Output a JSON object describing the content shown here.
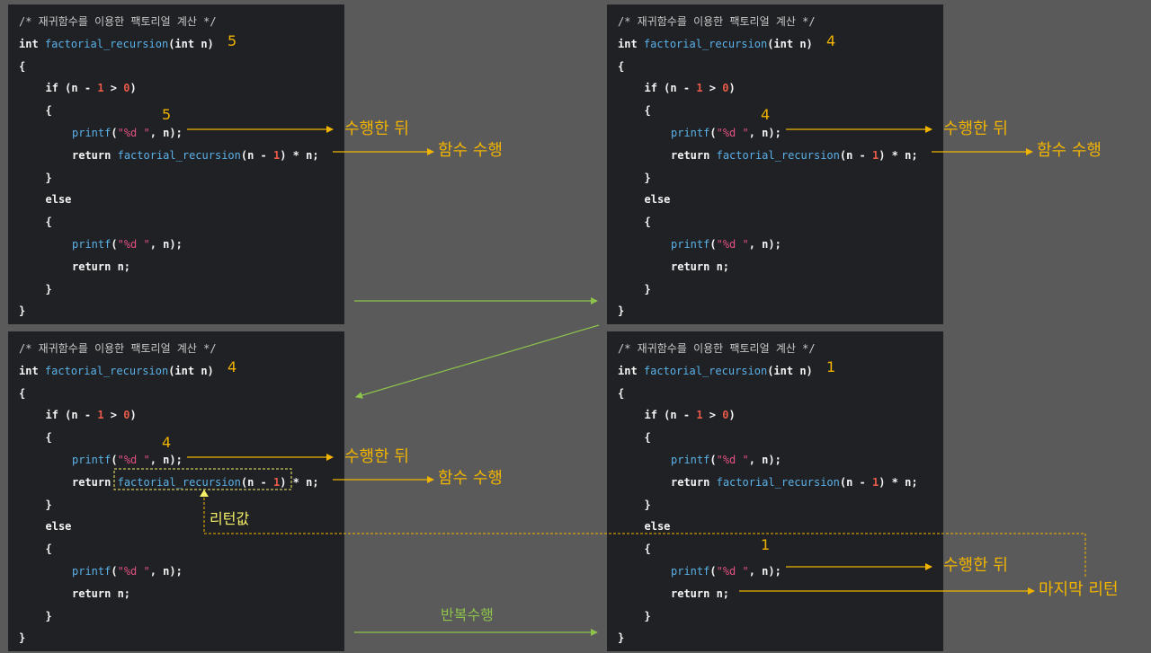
{
  "panels": [
    {
      "comment": "/* 재귀함수를 이용한 팩토리얼 계산 */",
      "type_kw": "int",
      "func_name": "factorial_recursion",
      "params": "(int n)",
      "open_brace": "{",
      "if_kw": "if",
      "cond_pre": " (n - ",
      "cond_num1": "1",
      "cond_mid": " > ",
      "cond_num2": "0",
      "cond_post": ")",
      "printf_fn": "printf",
      "printf_open": "(",
      "printf_str": "\"%d \"",
      "printf_args": ", n);",
      "return_kw": "return",
      "rec_call_pre": "(n - ",
      "rec_call_num": "1",
      "rec_call_post": ") * n;",
      "close_brace": "}",
      "else_kw": "else",
      "return_n": " n;",
      "param_value": "5",
      "printf_value": "5"
    },
    {
      "comment": "/* 재귀함수를 이용한 팩토리얼 계산 */",
      "type_kw": "int",
      "func_name": "factorial_recursion",
      "params": "(int n)",
      "open_brace": "{",
      "if_kw": "if",
      "cond_pre": " (n - ",
      "cond_num1": "1",
      "cond_mid": " > ",
      "cond_num2": "0",
      "cond_post": ")",
      "printf_fn": "printf",
      "printf_open": "(",
      "printf_str": "\"%d \"",
      "printf_args": ", n);",
      "return_kw": "return",
      "rec_call_pre": "(n - ",
      "rec_call_num": "1",
      "rec_call_post": ") * n;",
      "close_brace": "}",
      "else_kw": "else",
      "return_n": " n;",
      "param_value": "4",
      "printf_value": "4"
    },
    {
      "comment": "/* 재귀함수를 이용한 팩토리얼 계산 */",
      "type_kw": "int",
      "func_name": "factorial_recursion",
      "params": "(int n)",
      "open_brace": "{",
      "if_kw": "if",
      "cond_pre": " (n - ",
      "cond_num1": "1",
      "cond_mid": " > ",
      "cond_num2": "0",
      "cond_post": ")",
      "printf_fn": "printf",
      "printf_open": "(",
      "printf_str": "\"%d \"",
      "printf_args": ", n);",
      "return_kw": "return",
      "rec_call_pre": "(n - ",
      "rec_call_num": "1",
      "rec_call_post": ") * n;",
      "close_brace": "}",
      "else_kw": "else",
      "return_n": " n;",
      "param_value": "4",
      "printf_value": "4"
    },
    {
      "comment": "/* 재귀함수를 이용한 팩토리얼 계산 */",
      "type_kw": "int",
      "func_name": "factorial_recursion",
      "params": "(int n)",
      "open_brace": "{",
      "if_kw": "if",
      "cond_pre": " (n - ",
      "cond_num1": "1",
      "cond_mid": " > ",
      "cond_num2": "0",
      "cond_post": ")",
      "printf_fn": "printf",
      "printf_open": "(",
      "printf_str": "\"%d \"",
      "printf_args": ", n);",
      "return_kw": "return",
      "rec_call_pre": "(n - ",
      "rec_call_num": "1",
      "rec_call_post": ") * n;",
      "close_brace": "}",
      "else_kw": "else",
      "return_n": " n;",
      "param_value": "1",
      "printf_value": "1"
    }
  ],
  "annotations": {
    "after_exec": "수행한 뒤",
    "func_exec": "함수 수행",
    "return_value": "리턴값",
    "repeat": "반복수행",
    "last_return": "마지막 리턴"
  },
  "colors": {
    "background": "#5a5a5a",
    "panel": "#202124",
    "arrow_orange": "#f0b300",
    "arrow_green": "#8dc34a",
    "dashed_yellow": "#f5f067"
  }
}
